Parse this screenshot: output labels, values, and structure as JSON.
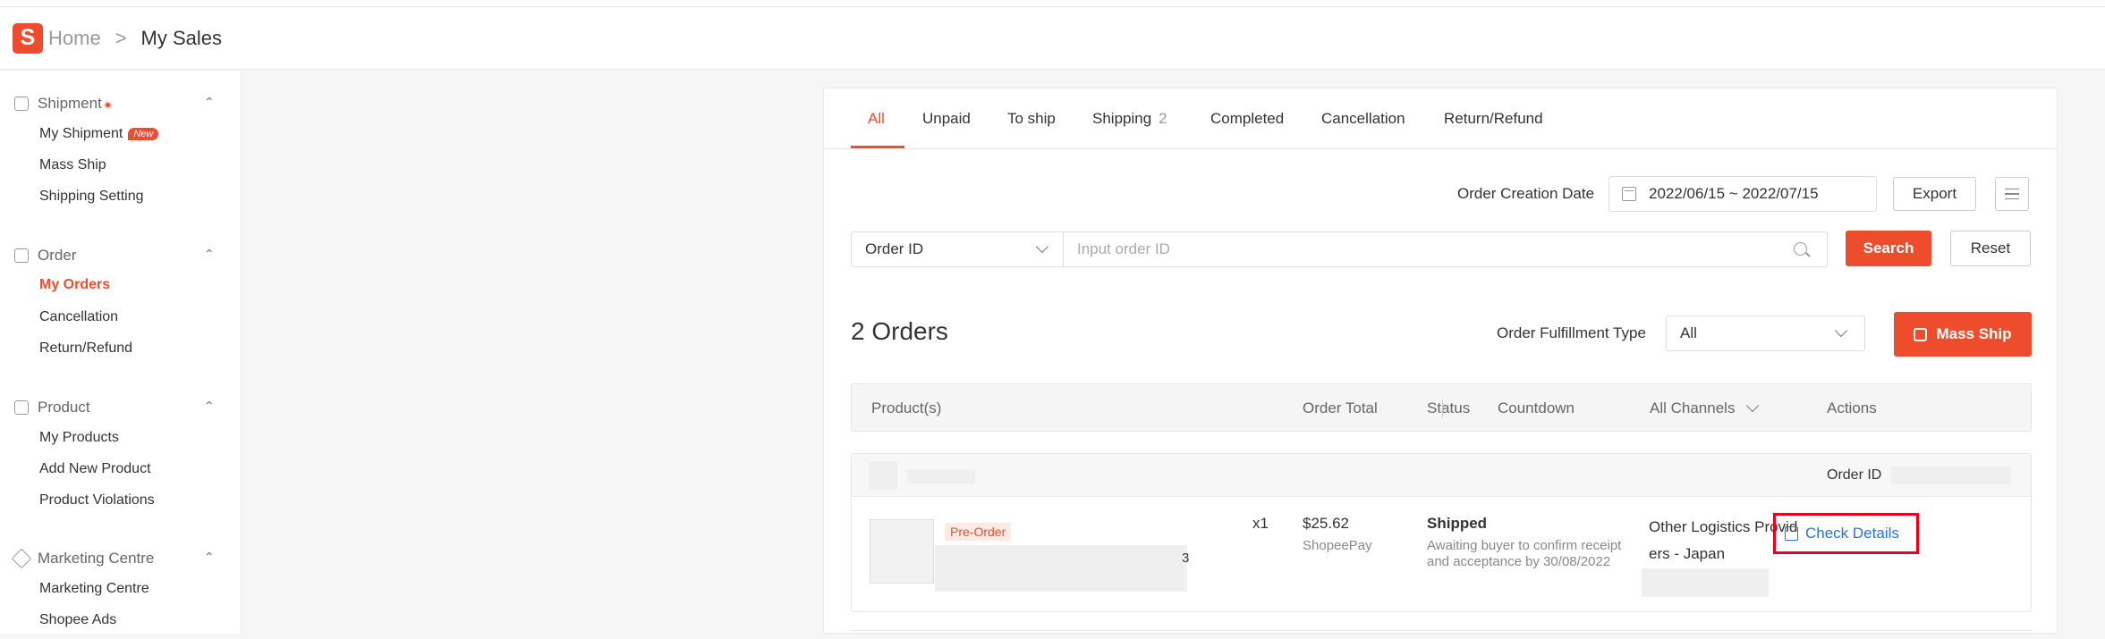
{
  "header": {
    "logo_letter": "S",
    "breadcrumb_home": "Home",
    "breadcrumb_sep": ">",
    "breadcrumb_current": "My Sales"
  },
  "sidebar": {
    "sections": [
      {
        "title": "Shipment",
        "icon": "package-icon",
        "has_dot": true,
        "items": [
          {
            "label": "My Shipment",
            "badge": "New"
          },
          {
            "label": "Mass Ship"
          },
          {
            "label": "Shipping Setting"
          }
        ]
      },
      {
        "title": "Order",
        "icon": "order-icon",
        "items": [
          {
            "label": "My Orders",
            "active": true
          },
          {
            "label": "Cancellation"
          },
          {
            "label": "Return/Refund"
          }
        ]
      },
      {
        "title": "Product",
        "icon": "product-icon",
        "items": [
          {
            "label": "My Products"
          },
          {
            "label": "Add New Product"
          },
          {
            "label": "Product Violations"
          }
        ]
      },
      {
        "title": "Marketing Centre",
        "icon": "tag-icon",
        "items": [
          {
            "label": "Marketing Centre"
          },
          {
            "label": "Shopee Ads"
          }
        ]
      }
    ]
  },
  "tabs": [
    {
      "label": "All",
      "active": true
    },
    {
      "label": "Unpaid"
    },
    {
      "label": "To ship"
    },
    {
      "label": "Shipping",
      "count": "2"
    },
    {
      "label": "Completed"
    },
    {
      "label": "Cancellation"
    },
    {
      "label": "Return/Refund"
    }
  ],
  "filters": {
    "date_label": "Order Creation Date",
    "date_range": "2022/06/15 ~ 2022/07/15",
    "export_label": "Export",
    "search_type": "Order ID",
    "search_placeholder": "Input order ID",
    "search_label": "Search",
    "reset_label": "Reset"
  },
  "orders": {
    "count_label": "2 Orders",
    "fulfillment_label": "Order Fulfillment Type",
    "fulfillment_value": "All",
    "mass_ship_label": "Mass Ship"
  },
  "table": {
    "headers": {
      "products": "Product(s)",
      "total": "Order Total",
      "status": "Status",
      "countdown": "Countdown",
      "channels": "All Channels",
      "actions": "Actions"
    }
  },
  "order_row": {
    "order_id_label": "Order ID",
    "tag": "Pre-Order",
    "qty": "x1",
    "total": "$25.62",
    "payment": "ShopeePay",
    "status": "Shipped",
    "status_note_1": "Awaiting buyer to confirm receipt",
    "status_note_2": "and acceptance by 30/08/2022",
    "channel_1": "Other Logistics Provid",
    "channel_2": "ers - Japan",
    "action": "Check Details"
  },
  "colors": {
    "brand": "#ee4d2d",
    "link": "#2673dd",
    "highlight": "#e8001c"
  }
}
